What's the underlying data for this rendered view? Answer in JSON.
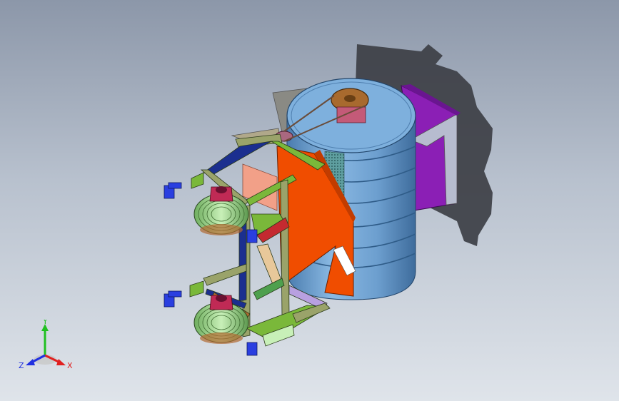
{
  "viewport": {
    "background_top": "#8c97a9",
    "background_bottom": "#dfe4ea"
  },
  "model": {
    "icon": "cad-assembly-model",
    "colors": {
      "drum": "#6d9fcf",
      "drum_top": "#7eb0dd",
      "drum_bands": "#4f7faf",
      "hopper": "#f04d00",
      "motor_box": "#8b1fb5",
      "pulley": "#a86a2e",
      "frame_green": "#7ab83a",
      "frame_olive": "#9aa36a",
      "frame_blue": "#1b2f8f",
      "wheel": "#9ed68e",
      "bearing": "#c02a55",
      "shadow": "#3d3f45"
    }
  },
  "triad": {
    "x_label": "X",
    "y_label": "Y",
    "z_label": "Z",
    "x_color": "#e02020",
    "y_color": "#20c020",
    "z_color": "#2030e0"
  }
}
